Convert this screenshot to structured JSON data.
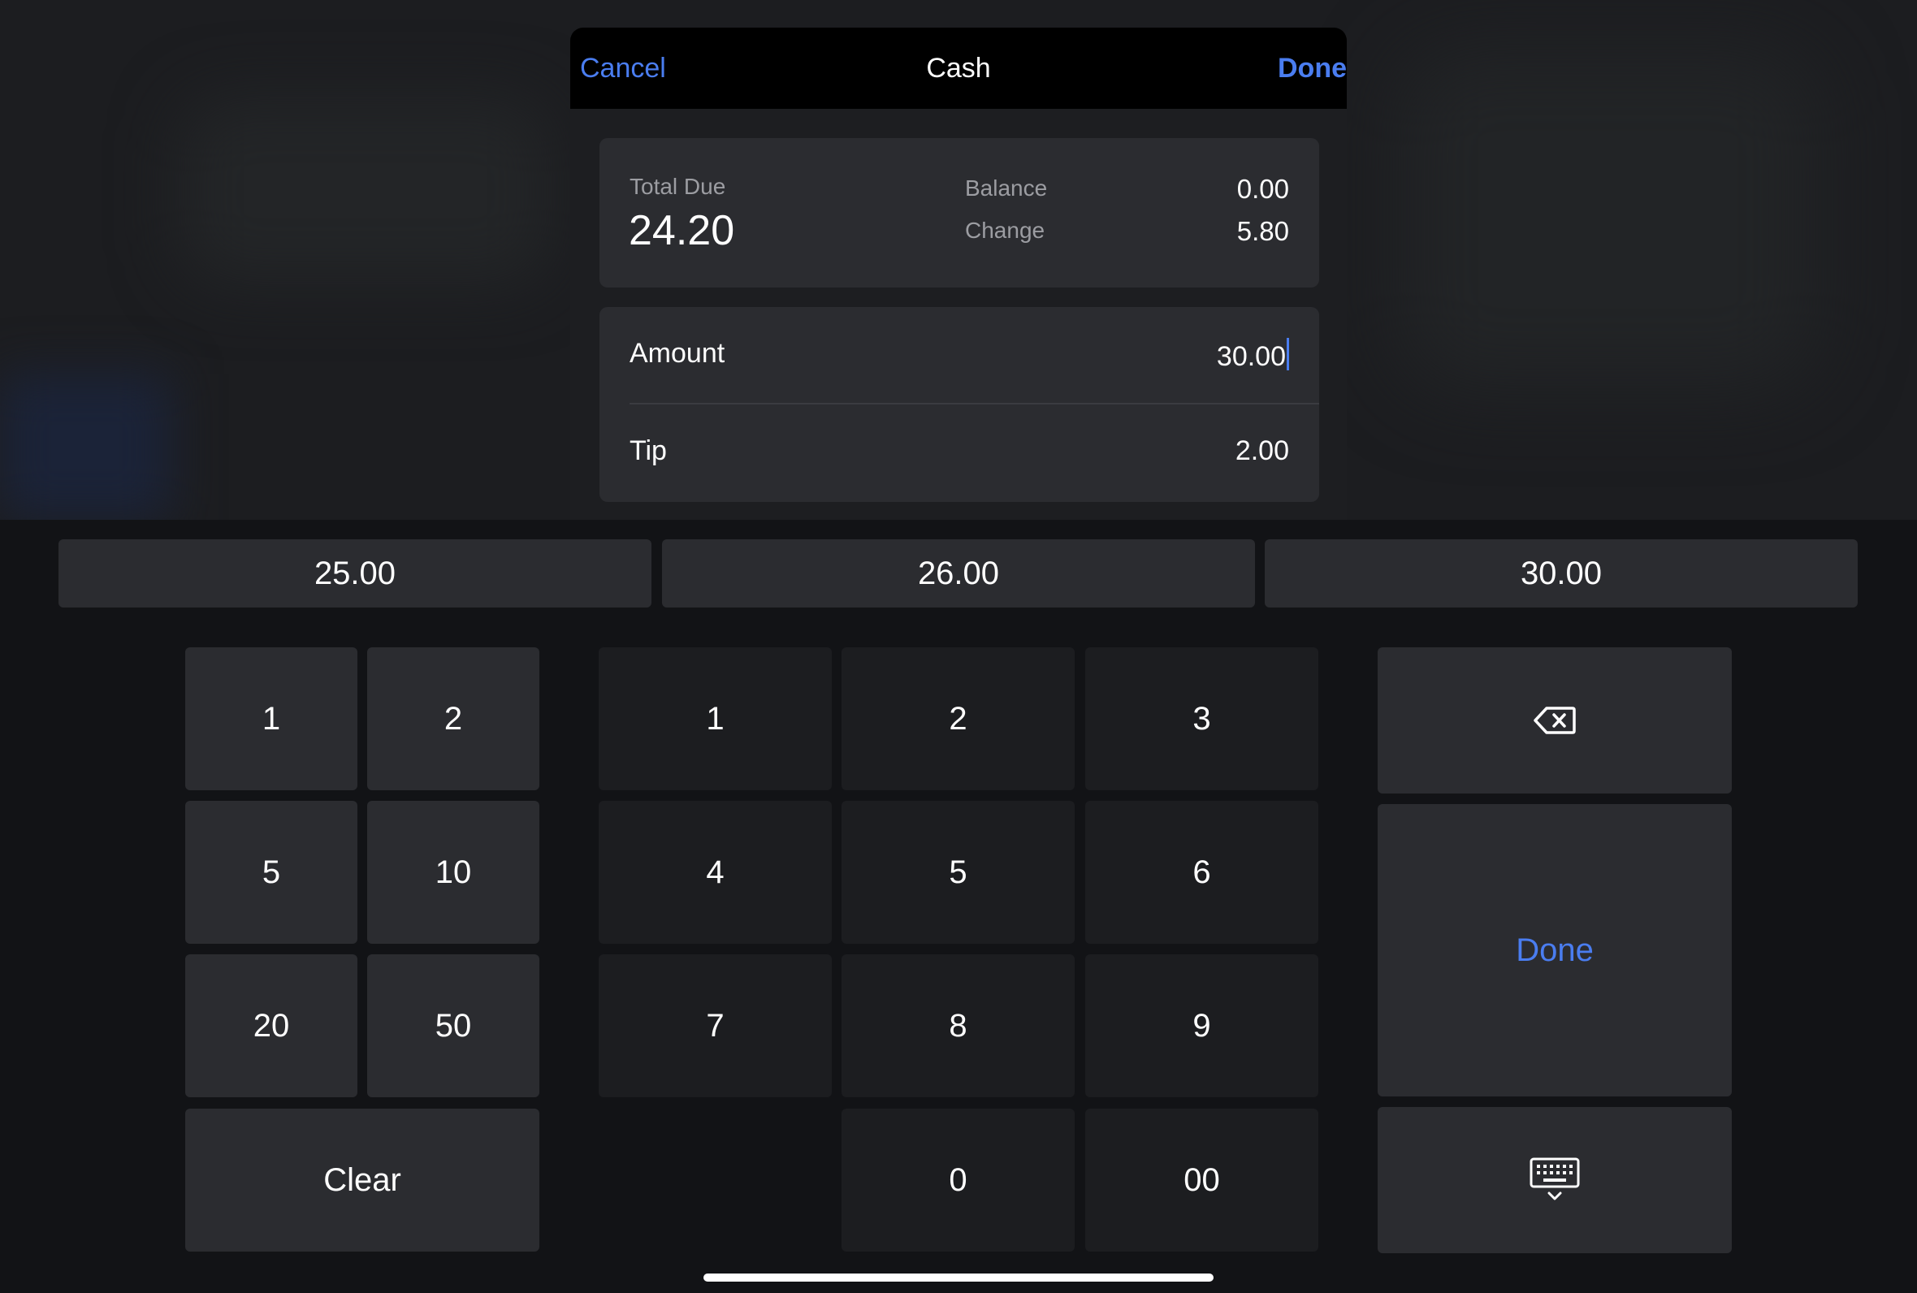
{
  "header": {
    "cancel_label": "Cancel",
    "title": "Cash",
    "done_label": "Done"
  },
  "summary": {
    "total_due_label": "Total Due",
    "total_due_value": "24.20",
    "balance_label": "Balance",
    "balance_value": "0.00",
    "change_label": "Change",
    "change_value": "5.80"
  },
  "fields": {
    "amount_label": "Amount",
    "amount_value": "30.00",
    "tip_label": "Tip",
    "tip_value": "2.00"
  },
  "quick_amounts": [
    "25.00",
    "26.00",
    "30.00"
  ],
  "denomination_keys": [
    "1",
    "2",
    "5",
    "10",
    "20",
    "50"
  ],
  "clear_label": "Clear",
  "digit_keys": [
    "1",
    "2",
    "3",
    "4",
    "5",
    "6",
    "7",
    "8",
    "9"
  ],
  "zero_label": "0",
  "double_zero_label": "00",
  "keyboard_done_label": "Done",
  "icons": {
    "backspace": "delete-left-icon",
    "dismiss_keyboard": "keyboard-dismiss-icon"
  },
  "colors": {
    "accent": "#4a7df0",
    "key_light": "#2b2c30",
    "key_dark": "#1c1d20",
    "keyboard_background": "#121316"
  }
}
